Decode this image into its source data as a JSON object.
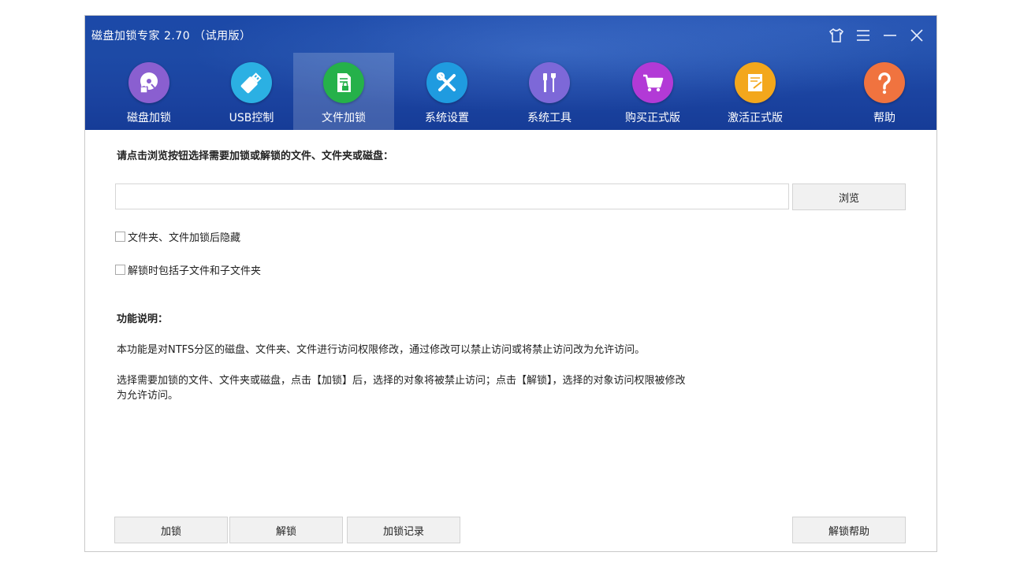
{
  "window": {
    "title": "磁盘加锁专家 2.70 （试用版）",
    "controls": [
      "skin-icon",
      "menu-icon",
      "minimize-icon",
      "close-icon"
    ]
  },
  "nav": {
    "items": [
      {
        "label": "磁盘加锁",
        "icon": "disk-lock-icon",
        "color": "#8a5fd0"
      },
      {
        "label": "USB控制",
        "icon": "usb-icon",
        "color": "#2bb0e3"
      },
      {
        "label": "文件加锁",
        "icon": "file-lock-icon",
        "color": "#25b14a",
        "active": true
      },
      {
        "label": "系统设置",
        "icon": "tools-icon",
        "color": "#1f9be0"
      },
      {
        "label": "系统工具",
        "icon": "screwdriver-icon",
        "color": "#7d68d8"
      },
      {
        "label": "购买正式版",
        "icon": "cart-icon",
        "color": "#b23ad6"
      },
      {
        "label": "激活正式版",
        "icon": "activate-icon",
        "color": "#f3a71c"
      },
      {
        "label": "帮助",
        "icon": "help-icon",
        "color": "#f0733f"
      }
    ]
  },
  "main": {
    "instruction": "请点击浏览按钮选择需要加锁或解锁的文件、文件夹或磁盘：",
    "path_value": "",
    "browse_label": "浏览",
    "options": [
      {
        "label": "文件夹、文件加锁后隐藏",
        "checked": false
      },
      {
        "label": "解锁时包括子文件和子文件夹",
        "checked": false
      }
    ],
    "section_title": "功能说明：",
    "desc1": "本功能是对NTFS分区的磁盘、文件夹、文件进行访问权限修改，通过修改可以禁止访问或将禁止访问改为允许访问。",
    "desc2_line1": "选择需要加锁的文件、文件夹或磁盘，点击【加锁】后，选择的对象将被禁止访问；点击【解锁】，选择的对象访问权限被修改",
    "desc2_line2": "为允许访问。"
  },
  "footer": {
    "lock_label": "加锁",
    "unlock_label": "解锁",
    "log_label": "加锁记录",
    "help_label": "解锁帮助"
  }
}
